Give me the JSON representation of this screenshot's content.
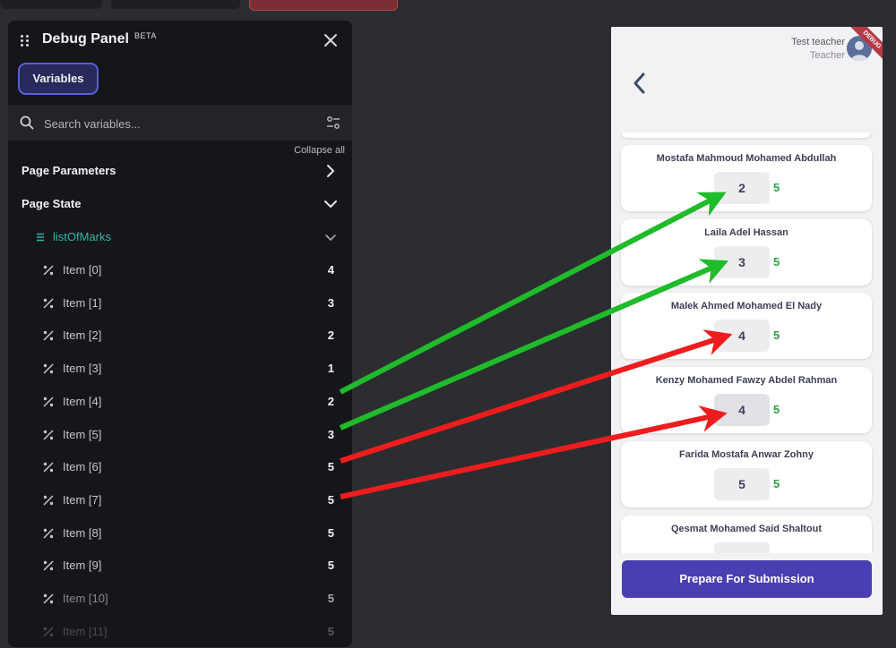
{
  "colors": {
    "panel_bg": "#15161a",
    "accent": "#5a5fd6",
    "list_teal": "#2fb5a6",
    "total_green": "#27a246",
    "submit_purple": "#4a3fb2",
    "arrow_green": "#1fbb2a",
    "arrow_red": "#ee1d1d"
  },
  "debug_panel": {
    "title": "Debug Panel",
    "badge": "BETA",
    "tab_variables": "Variables",
    "search": {
      "placeholder": "Search variables..."
    },
    "collapse_all": "Collapse all",
    "page_parameters": "Page Parameters",
    "page_state": "Page State",
    "list_name": "listOfMarks",
    "items": [
      {
        "label": "Item [0]",
        "value": "4"
      },
      {
        "label": "Item [1]",
        "value": "3"
      },
      {
        "label": "Item [2]",
        "value": "2"
      },
      {
        "label": "Item [3]",
        "value": "1"
      },
      {
        "label": "Item [4]",
        "value": "2"
      },
      {
        "label": "Item [5]",
        "value": "3"
      },
      {
        "label": "Item [6]",
        "value": "5"
      },
      {
        "label": "Item [7]",
        "value": "5"
      },
      {
        "label": "Item [8]",
        "value": "5"
      },
      {
        "label": "Item [9]",
        "value": "5"
      },
      {
        "label": "Item [10]",
        "value": "5"
      },
      {
        "label": "Item [11]",
        "value": "5"
      }
    ]
  },
  "app": {
    "user_name": "Test teacher",
    "user_role": "Teacher",
    "debug_ribbon": "DEBUG",
    "students": [
      {
        "name": "Mostafa Mahmoud Mohamed Abdullah",
        "mark": "2",
        "total": "5"
      },
      {
        "name": "Laila  Adel Hassan",
        "mark": "3",
        "total": "5"
      },
      {
        "name": "Malek Ahmed Mohamed El Nady",
        "mark": "4",
        "total": "5"
      },
      {
        "name": "Kenzy Mohamed Fawzy Abdel Rahman",
        "mark": "4",
        "total": "5"
      },
      {
        "name": "Farida Mostafa Anwar Zohny",
        "mark": "5",
        "total": "5"
      },
      {
        "name": "Qesmat Mohamed Said Shaltout",
        "mark": "",
        "total": ""
      }
    ],
    "submit_label": "Prepare For Submission"
  }
}
